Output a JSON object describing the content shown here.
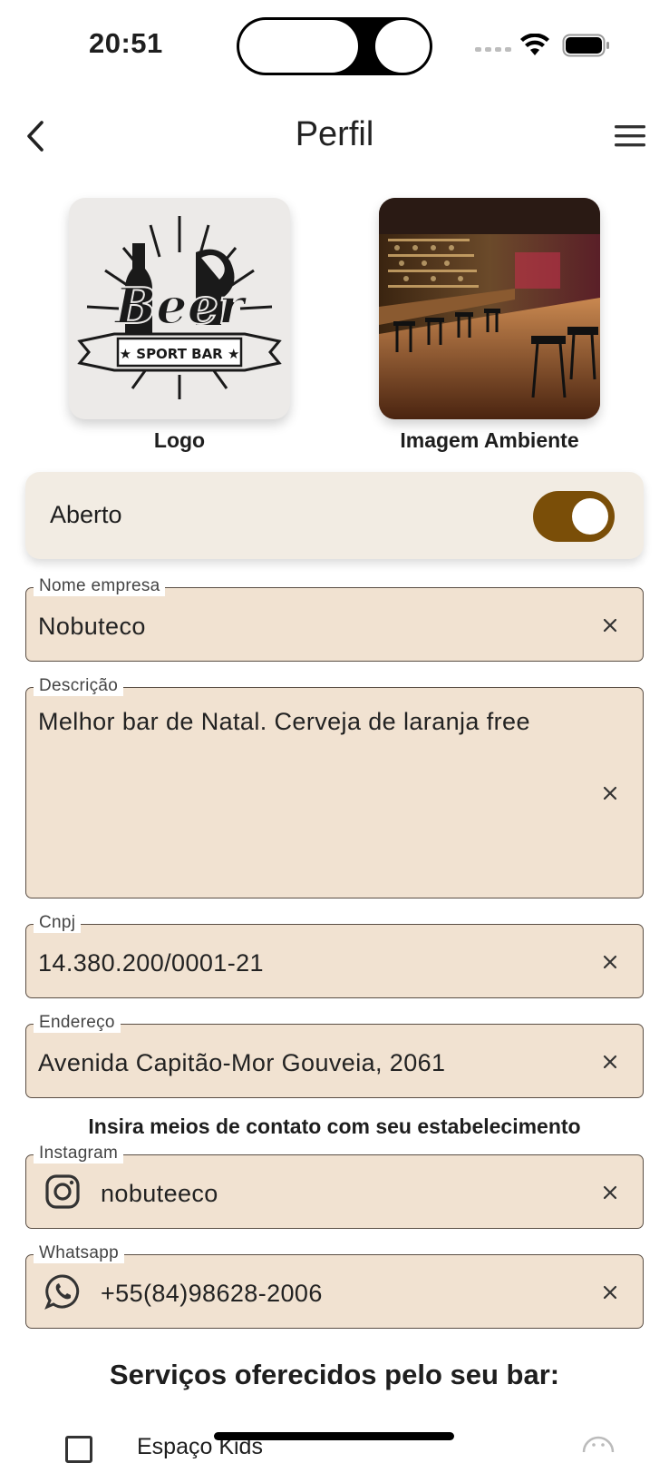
{
  "status": {
    "time": "20:51"
  },
  "header": {
    "title": "Perfil"
  },
  "images": {
    "logo_caption": "Logo",
    "ambient_caption": "Imagem Ambiente"
  },
  "open_toggle": {
    "label": "Aberto",
    "on": true
  },
  "fields": {
    "company": {
      "label": "Nome empresa",
      "value": "Nobuteco"
    },
    "description": {
      "label": "Descrição",
      "value": "Melhor bar de Natal. Cerveja de laranja free"
    },
    "cnpj": {
      "label": "Cnpj",
      "value": "14.380.200/0001-21"
    },
    "address": {
      "label": "Endereço",
      "value": "Avenida Capitão-Mor Gouveia, 2061"
    }
  },
  "contact": {
    "hint": "Insira meios de contato com seu estabelecimento",
    "instagram": {
      "label": "Instagram",
      "value": "nobuteeco",
      "icon": "instagram-icon"
    },
    "whatsapp": {
      "label": "Whatsapp",
      "value": "+55(84)98628-2006",
      "icon": "whatsapp-icon"
    }
  },
  "services": {
    "title": "Serviços oferecidos pelo seu bar:",
    "items": [
      {
        "label": "Espaço Kids",
        "checked": false,
        "icon": "kids-icon"
      }
    ]
  },
  "colors": {
    "accent": "#7a4e08",
    "field_bg": "#f1e2d1",
    "card_bg": "#f2ece3"
  }
}
